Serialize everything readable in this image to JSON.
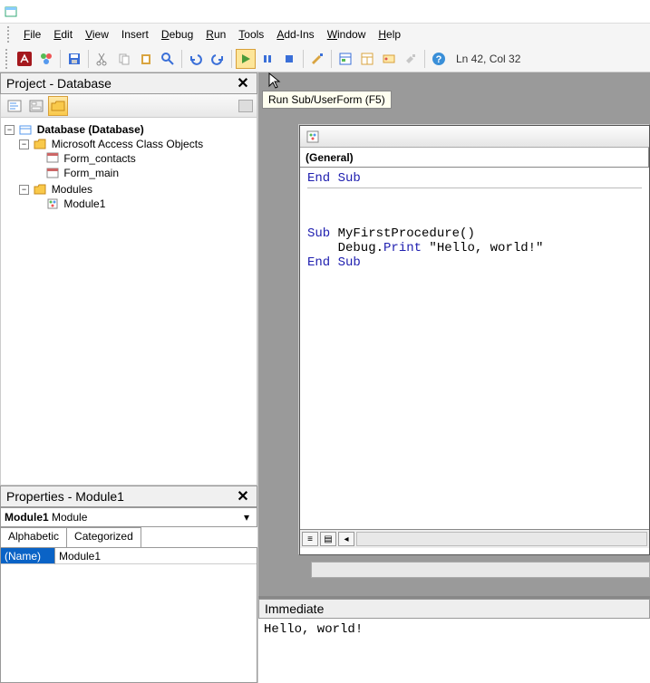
{
  "menu": {
    "file": "File",
    "edit": "Edit",
    "view": "View",
    "insert": "Insert",
    "debug": "Debug",
    "run": "Run",
    "tools": "Tools",
    "addins": "Add-Ins",
    "window": "Window",
    "help": "Help"
  },
  "toolbar": {
    "status": "Ln 42, Col 32",
    "tooltip": "Run Sub/UserForm (F5)"
  },
  "project": {
    "title": "Project - Database",
    "root": "Database (Database)",
    "class_objects": "Microsoft Access Class Objects",
    "form1": "Form_contacts",
    "form2": "Form_main",
    "modules": "Modules",
    "module1": "Module1"
  },
  "properties": {
    "title": "Properties - Module1",
    "combo_name": "Module1",
    "combo_type": "Module",
    "tab1": "Alphabetic",
    "tab2": "Categorized",
    "row_name": "(Name)",
    "row_val": "Module1"
  },
  "code": {
    "combo_left": "(General)",
    "line1_kw": "End Sub",
    "line2_kw1": "Sub",
    "line2_txt": " MyFirstProcedure()",
    "line3_txt1": "    Debug.",
    "line3_kw": "Print",
    "line3_txt2": " \"Hello, world!\"",
    "line4_kw": "End Sub"
  },
  "immediate": {
    "title": "Immediate",
    "output": "Hello, world!"
  }
}
